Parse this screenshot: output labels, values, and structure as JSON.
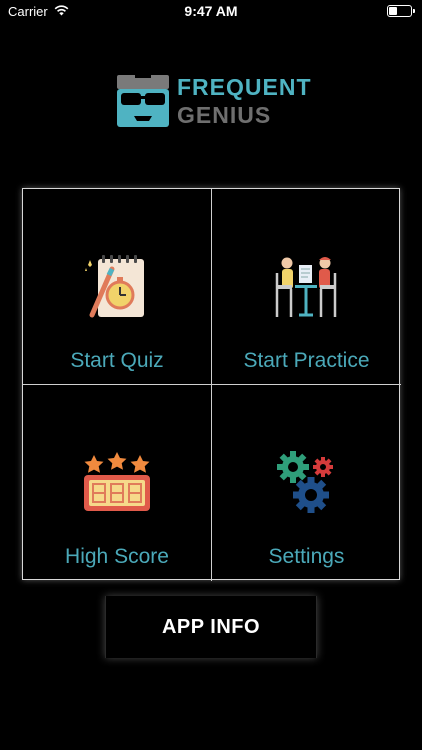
{
  "status_bar": {
    "carrier": "Carrier",
    "time": "9:47 AM",
    "wifi_icon": "wifi-icon",
    "battery_icon": "battery-icon"
  },
  "logo": {
    "line1": "FREQUENT",
    "line2": "GENIUS",
    "icon": "glasses-mascot-icon",
    "primary_color": "#4fb3c2",
    "secondary_color": "#6f6f6f"
  },
  "menu": {
    "items": [
      {
        "label": "Start Quiz",
        "icon": "notepad-stopwatch-icon"
      },
      {
        "label": "Start Practice",
        "icon": "people-at-table-icon"
      },
      {
        "label": "High Score",
        "icon": "scoreboard-stars-icon"
      },
      {
        "label": "Settings",
        "icon": "gears-icon"
      }
    ],
    "label_color": "#4ba9b9"
  },
  "app_info": {
    "label": "APP INFO"
  }
}
